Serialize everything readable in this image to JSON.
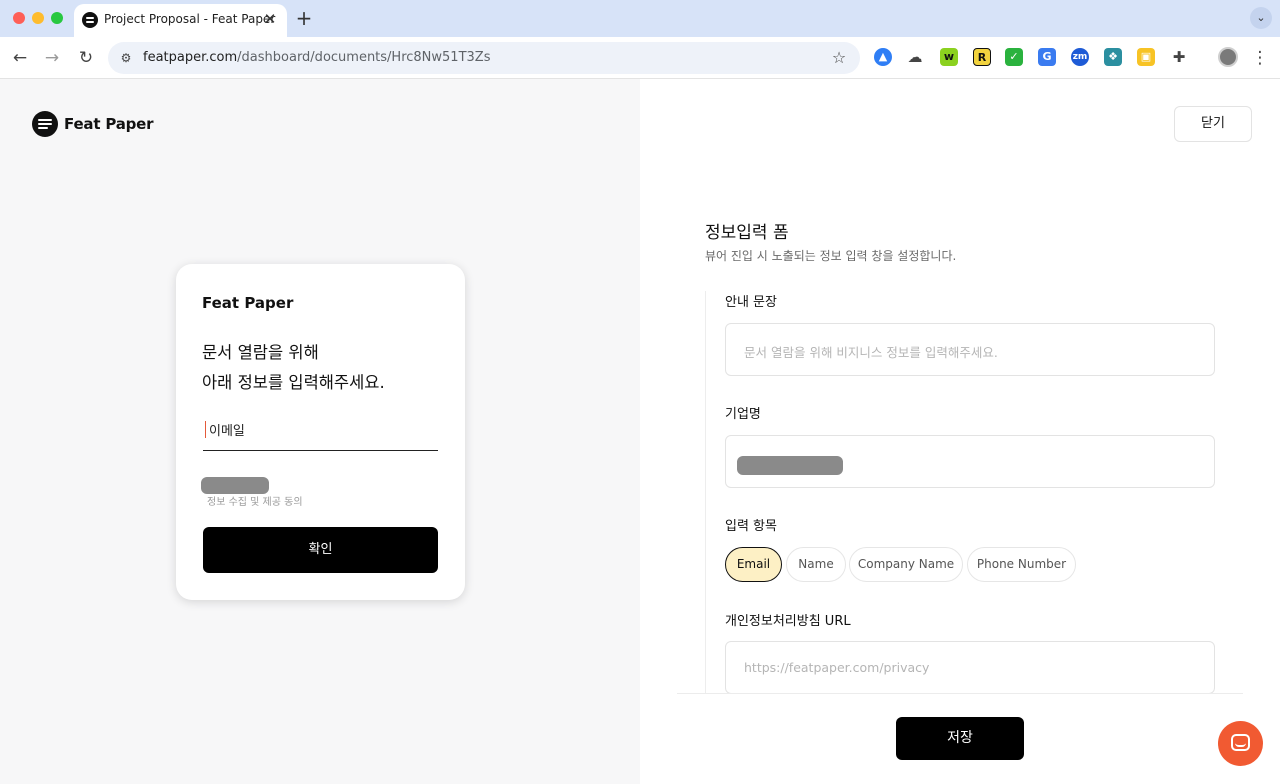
{
  "browser": {
    "tab_title": "Project Proposal - Feat Paper",
    "tab_close": "✕",
    "new_tab": "+",
    "tabbar_menu": "⌄",
    "url_host": "featpaper.com",
    "url_path": "/dashboard/documents/Hrc8Nw51T3Zs",
    "nav_back": "←",
    "nav_forward": "→",
    "nav_reload": "↻",
    "site_info": "⚙",
    "bookmark": "☆",
    "menu": "⋮",
    "extensions": [
      {
        "name": "a-icon",
        "glyph": "▲"
      },
      {
        "name": "cloud-icon",
        "glyph": "☁"
      },
      {
        "name": "w-icon",
        "glyph": "w"
      },
      {
        "name": "r-icon",
        "glyph": "R"
      },
      {
        "name": "check-icon",
        "glyph": "✓"
      },
      {
        "name": "translate-icon",
        "glyph": "G"
      },
      {
        "name": "zm-icon",
        "glyph": "zm"
      },
      {
        "name": "pattern-icon",
        "glyph": "❖"
      },
      {
        "name": "note-icon",
        "glyph": "▣"
      },
      {
        "name": "puzzle-icon",
        "glyph": "✚"
      }
    ]
  },
  "app": {
    "logo_text": "Feat Paper",
    "close_button": "닫기"
  },
  "preview_card": {
    "brand": "Feat Paper",
    "message_line1": "문서 열람을 위해",
    "message_line2": "아래 정보를 입력해주세요.",
    "email_placeholder": "이메일",
    "consent_text": "정보 수집 및 제공 동의",
    "confirm_button": "확인"
  },
  "form": {
    "title": "정보입력 폼",
    "description": "뷰어 진입 시 노출되는 정보 입력 창을 설정합니다.",
    "guide_label": "안내 문장",
    "guide_placeholder": "문서 열람을 위해 비지니스 정보를 입력해주세요.",
    "company_label": "기업명",
    "fields_label": "입력 항목",
    "chips": [
      {
        "label": "Email",
        "active": true
      },
      {
        "label": "Name",
        "active": false
      },
      {
        "label": "Company Name",
        "active": false
      },
      {
        "label": "Phone Number",
        "active": false
      }
    ],
    "privacy_label": "개인정보처리방침 URL",
    "privacy_placeholder": "https://featpaper.com/privacy",
    "save_button": "저장"
  },
  "colors": {
    "accent": "#000000",
    "chip_active_bg": "#fdf0c5",
    "chat_fab": "#f15a32",
    "left_pane_bg": "#f7f7f8"
  }
}
